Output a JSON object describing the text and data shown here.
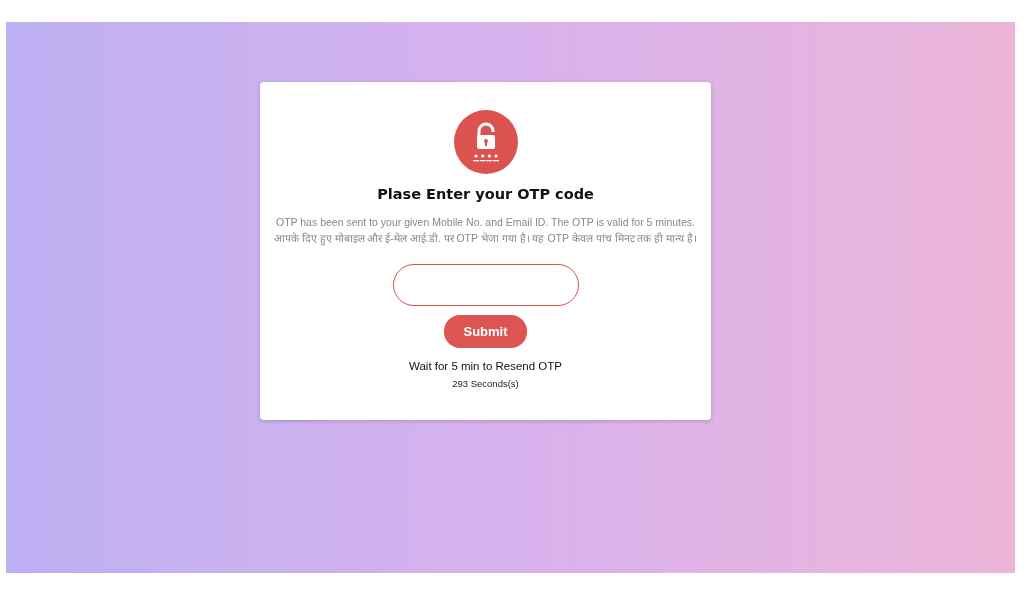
{
  "card": {
    "title": "Plase Enter your OTP code",
    "message_en": "OTP has been sent to your given Mobile No. and Email ID. The OTP is valid for 5 minutes.",
    "message_hi": "आपके दिए हुए मोबाइल और ई-मेल आई.डी. पर OTP भेजा गया है। यह OTP केवल पांच मिनट तक ही मान्य है।",
    "submit": "Submit",
    "wait": "Wait for 5 min to Resend OTP",
    "countdown": "293 Seconds(s)"
  }
}
